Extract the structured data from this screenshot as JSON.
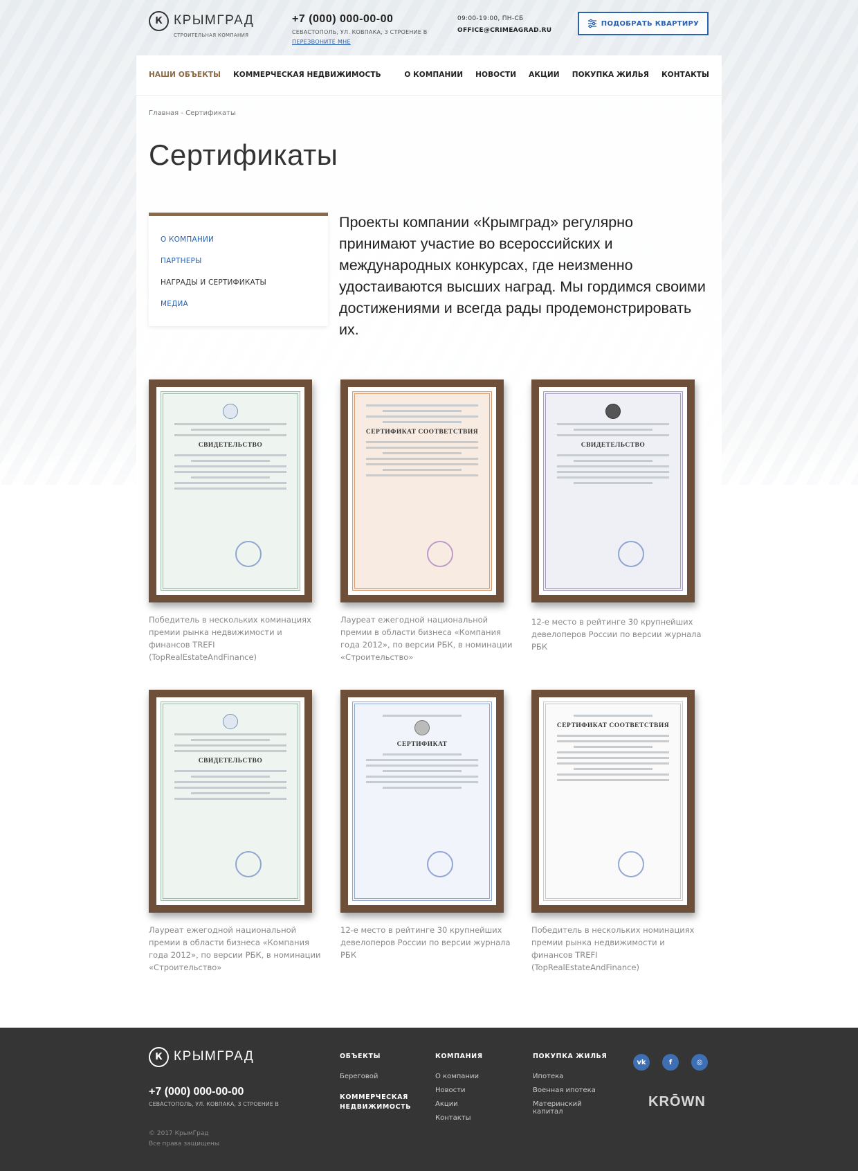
{
  "header": {
    "logo_mark": "К",
    "logo_name": "КРЫМГРАД",
    "logo_sub": "СТРОИТЕЛЬНАЯ КОМПАНИЯ",
    "phone": "+7 (000) 000-00-00",
    "address": "СЕВАСТОПОЛЬ, УЛ. КОВПАКА, 3 СТРОЕНИЕ В",
    "callback": "ПЕРЕЗВОНИТЕ МНЕ",
    "hours": "09:00-19:00, ПН-СБ",
    "email": "OFFICE@CRIMEAGRAD.RU",
    "cta_button": "ПОДОБРАТЬ КВАРТИРУ"
  },
  "nav": {
    "left": [
      "НАШИ ОБЪЕКТЫ",
      "КОММЕРЧЕСКАЯ НЕДВИЖИМОСТЬ"
    ],
    "right": [
      "О КОМПАНИИ",
      "НОВОСТИ",
      "АКЦИИ",
      "ПОКУПКА ЖИЛЬЯ",
      "КОНТАКТЫ"
    ]
  },
  "breadcrumb": "Главная - Сертификаты",
  "title": "Сертификаты",
  "sidemenu": [
    "О КОМПАНИИ",
    "ПАРТНЕРЫ",
    "НАГРАДЫ И СЕРТИФИКАТЫ",
    "МЕДИА"
  ],
  "intro": "Проекты компании «Крымград» регулярно принимают участие во всероссийских и международных конкурсах, где неизменно удостаиваются высших наград. Мы гордимся своими достижениями и всегда рады продемонстрировать их.",
  "certificates": [
    {
      "heading": "СВИДЕТЕЛЬСТВО",
      "caption": "Победитель в нескольких коминациях премии рынка недвижимости и финансов TREFI (TopRealEstateAndFinance)"
    },
    {
      "heading": "СЕРТИФИКАТ СООТВЕТСТВИЯ",
      "caption": "Лауреат ежегодной национальной премии в области бизнеса «Компания года 2012», по версии РБК, в номинации «Строительство»"
    },
    {
      "heading": "СВИДЕТЕЛЬСТВО",
      "caption": "12-е место в рейтинге 30 крупнейших девелоперов России по версии журнала РБК"
    },
    {
      "heading": "СВИДЕТЕЛЬСТВО",
      "caption": "Лауреат ежегодной национальной премии в области бизнеса «Компания года 2012», по версии РБК, в номинации «Строительство»"
    },
    {
      "heading": "СЕРТИФИКАТ",
      "caption": "12-е место в рейтинге 30 крупнейших девелоперов России по версии журнала РБК"
    },
    {
      "heading": "СЕРТИФИКАТ СООТВЕТСТВИЯ",
      "caption": "Победитель в нескольких номинациях премии рынка недвижимости и финансов TREFI (TopRealEstateAndFinance)"
    }
  ],
  "footer": {
    "phone": "+7 (000) 000-00-00",
    "address": "СЕВАСТОПОЛЬ, УЛ. КОВПАКА, 3 СТРОЕНИЕ В",
    "copyright": "© 2017 КрымГрад",
    "rights": "Все права защищены",
    "col_objects": {
      "title": "ОБЪЕКТЫ",
      "items": [
        "Береговой"
      ],
      "sub_title": "КОММЕРЧЕСКАЯ НЕДВИЖИМОСТЬ"
    },
    "col_company": {
      "title": "КОМПАНИЯ",
      "items": [
        "О компании",
        "Новости",
        "Акции",
        "Контакты"
      ]
    },
    "col_purchase": {
      "title": "ПОКУПКА ЖИЛЬЯ",
      "items": [
        "Ипотека",
        "Военная ипотека",
        "Материнский капитал"
      ]
    },
    "social": [
      "vk-icon",
      "facebook-icon",
      "instagram-icon"
    ],
    "social_glyphs": [
      "vk",
      "f",
      "◎"
    ],
    "krown": "KRŌWN"
  },
  "colors": {
    "accent_blue": "#2a62b0",
    "accent_brown": "#8b6a48",
    "footer_bg": "#353535"
  }
}
